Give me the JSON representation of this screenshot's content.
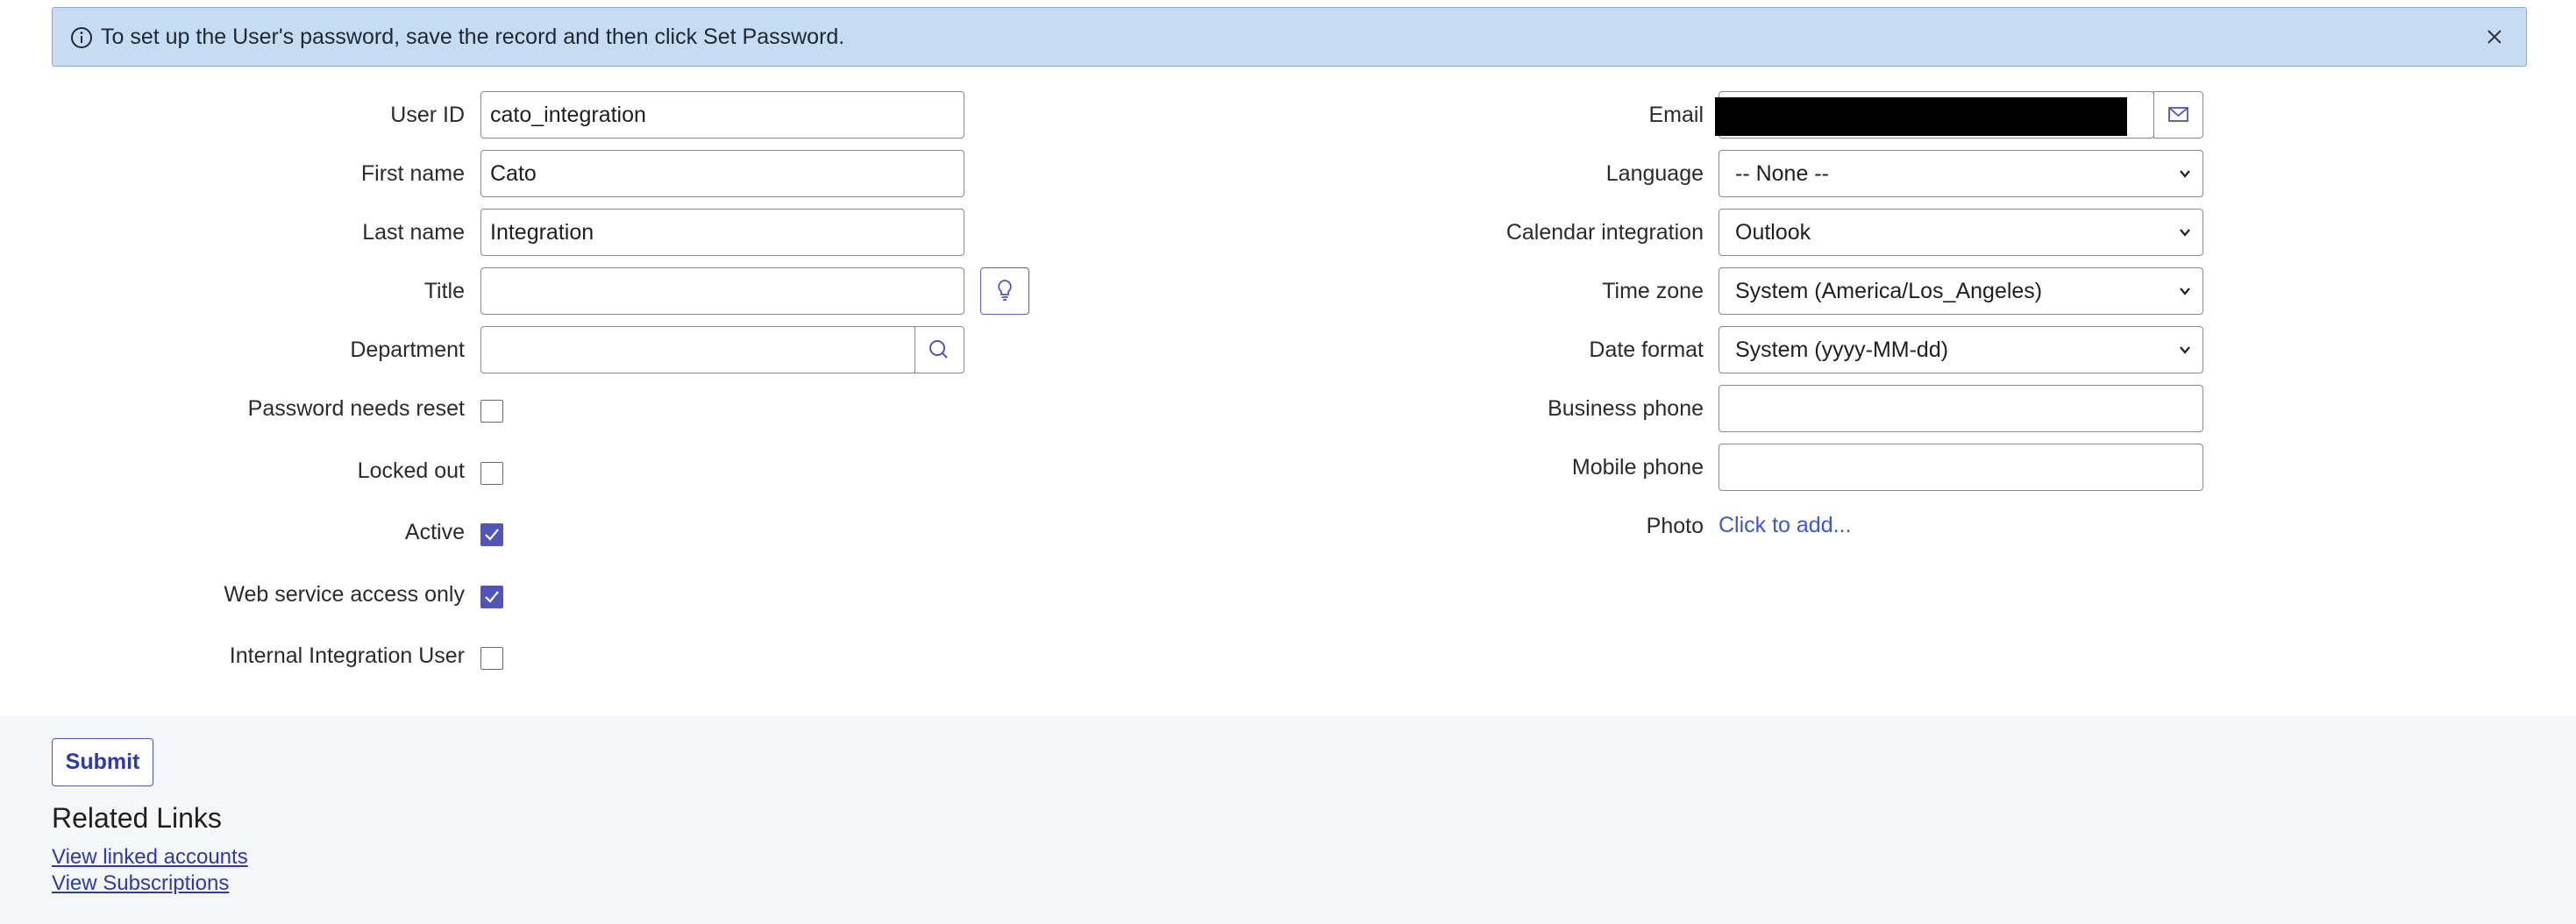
{
  "banner": {
    "message": "To set up the User's password, save the record and then click Set Password."
  },
  "left_fields": {
    "user_id": {
      "label": "User ID",
      "value": "cato_integration"
    },
    "first_name": {
      "label": "First name",
      "value": "Cato"
    },
    "last_name": {
      "label": "Last name",
      "value": "Integration"
    },
    "title": {
      "label": "Title",
      "value": ""
    },
    "department": {
      "label": "Department",
      "value": ""
    }
  },
  "checkboxes": {
    "password_needs_reset": {
      "label": "Password needs reset",
      "checked": false
    },
    "locked_out": {
      "label": "Locked out",
      "checked": false
    },
    "active": {
      "label": "Active",
      "checked": true
    },
    "web_service_access_only": {
      "label": "Web service access only",
      "checked": true
    },
    "internal_integration_user": {
      "label": "Internal Integration User",
      "checked": false
    }
  },
  "right_fields": {
    "email": {
      "label": "Email",
      "value": ""
    },
    "language": {
      "label": "Language",
      "value": "-- None --"
    },
    "calendar_integration": {
      "label": "Calendar integration",
      "value": "Outlook"
    },
    "time_zone": {
      "label": "Time zone",
      "value": "System (America/Los_Angeles)"
    },
    "date_format": {
      "label": "Date format",
      "value": "System (yyyy-MM-dd)"
    },
    "business_phone": {
      "label": "Business phone",
      "value": ""
    },
    "mobile_phone": {
      "label": "Mobile phone",
      "value": ""
    },
    "photo": {
      "label": "Photo",
      "link": "Click to add..."
    }
  },
  "footer": {
    "submit_label": "Submit",
    "related_links_title": "Related Links",
    "links": [
      "View linked accounts",
      "View Subscriptions"
    ]
  },
  "colors": {
    "banner_bg": "#c5dcf2",
    "accent": "#4f56b8",
    "link": "#2f3aa8"
  },
  "icons": [
    "info-icon",
    "close-icon",
    "lightbulb-icon",
    "search-icon",
    "mail-icon",
    "chevron-down-icon",
    "checkmark-icon"
  ]
}
